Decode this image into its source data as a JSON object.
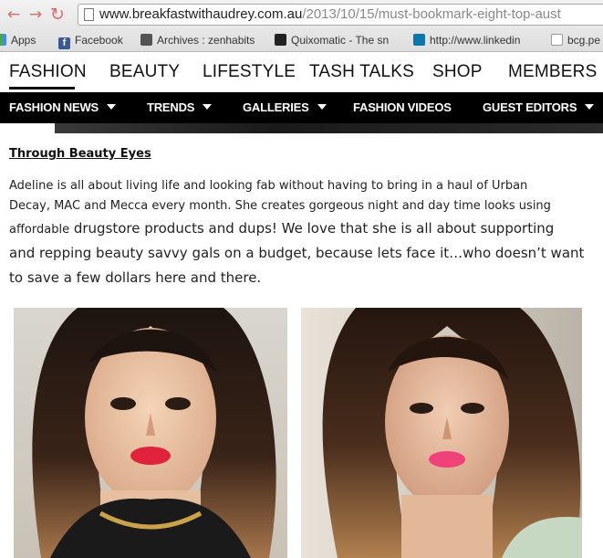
{
  "browser": {
    "url_host": "www.breakfastwithaudrey.com.au",
    "url_path": "/2013/10/15/must-bookmark-eight-top-aust",
    "bookmarks": [
      "Apps",
      "Facebook",
      "Archives : zenhabits",
      "Quixomatic - The sn",
      "http://www.linkedin",
      "bcg.pe"
    ]
  },
  "main_nav": [
    "FASHION",
    "BEAUTY",
    "LIFESTYLE",
    "TASH TALKS",
    "SHOP",
    "MEMBERS"
  ],
  "sub_nav": [
    "FASHION NEWS",
    "TRENDS",
    "GALLERIES",
    "FASHION VIDEOS",
    "GUEST EDITORS"
  ],
  "article": {
    "heading": "Through Beauty Eyes",
    "line1": "Adeline is all about living life and looking fab without having to bring in a haul of Urban",
    "line2": "Decay, MAC and Mecca every month. She creates gorgeous night and day time looks using",
    "line3_small": "affordable",
    "line3_rest": " drugstore products and dups! We love that she is all about supporting",
    "line4": "and repping beauty savvy gals on a budget, because lets face it…who doesn’t want",
    "line5": "to save a few dollars here and there."
  },
  "colors": {
    "nav_bg": "#000000",
    "accent_lips_left": "#e0233c",
    "accent_lips_right": "#f0427a"
  }
}
